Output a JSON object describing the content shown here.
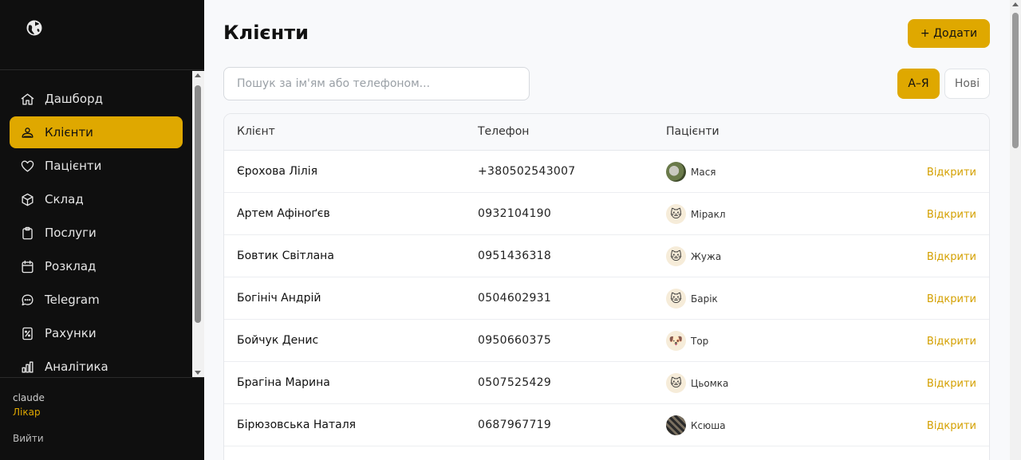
{
  "sidebar": {
    "logo_icon": "globe-logo-icon",
    "items": [
      {
        "label": "Дашборд",
        "icon": "home-icon"
      },
      {
        "label": "Клієнти",
        "icon": "users-icon",
        "active": true
      },
      {
        "label": "Пацієнти",
        "icon": "heart-icon"
      },
      {
        "label": "Склад",
        "icon": "box-icon"
      },
      {
        "label": "Послуги",
        "icon": "clipboard-icon"
      },
      {
        "label": "Розклад",
        "icon": "calendar-icon"
      },
      {
        "label": "Telegram",
        "icon": "chat-icon"
      },
      {
        "label": "Рахунки",
        "icon": "receipt-icon"
      },
      {
        "label": "Аналітика",
        "icon": "bar-chart-icon"
      }
    ],
    "user": {
      "name": "claude",
      "role": "Лікар"
    },
    "logout_label": "Вийти"
  },
  "header": {
    "title": "Клієнти",
    "add_label": "+ Додати"
  },
  "search": {
    "placeholder": "Пошук за ім'ям або телефоном...",
    "value": ""
  },
  "sort": {
    "az_label": "А–Я",
    "new_label": "Нові",
    "active": "az"
  },
  "table": {
    "columns": [
      "Клієнт",
      "Телефон",
      "Пацієнти"
    ],
    "open_label": "Відкрити",
    "rows": [
      {
        "client": "Єрохова Лілія",
        "phone": "+380502543007",
        "pet": "Мася",
        "avatar": "photo"
      },
      {
        "client": "Артем Афіноґєв",
        "phone": "0932104190",
        "pet": "Міракл",
        "avatar": "cat"
      },
      {
        "client": "Бовтик Світлана",
        "phone": "0951436318",
        "pet": "Жужа",
        "avatar": "cat"
      },
      {
        "client": "Богініч Андрій",
        "phone": "0504602931",
        "pet": "Барік",
        "avatar": "cat"
      },
      {
        "client": "Бойчук Денис",
        "phone": "0950660375",
        "pet": "Тор",
        "avatar": "dog"
      },
      {
        "client": "Брагіна Марина",
        "phone": "0507525429",
        "pet": "Цьомка",
        "avatar": "cat"
      },
      {
        "client": "Бірюзовська Наталя",
        "phone": "0687967719",
        "pet": "Ксюша",
        "avatar": "photo"
      }
    ]
  },
  "colors": {
    "accent": "#dfa800",
    "sidebar_bg": "#0f0f0f",
    "link": "#d4a000"
  }
}
